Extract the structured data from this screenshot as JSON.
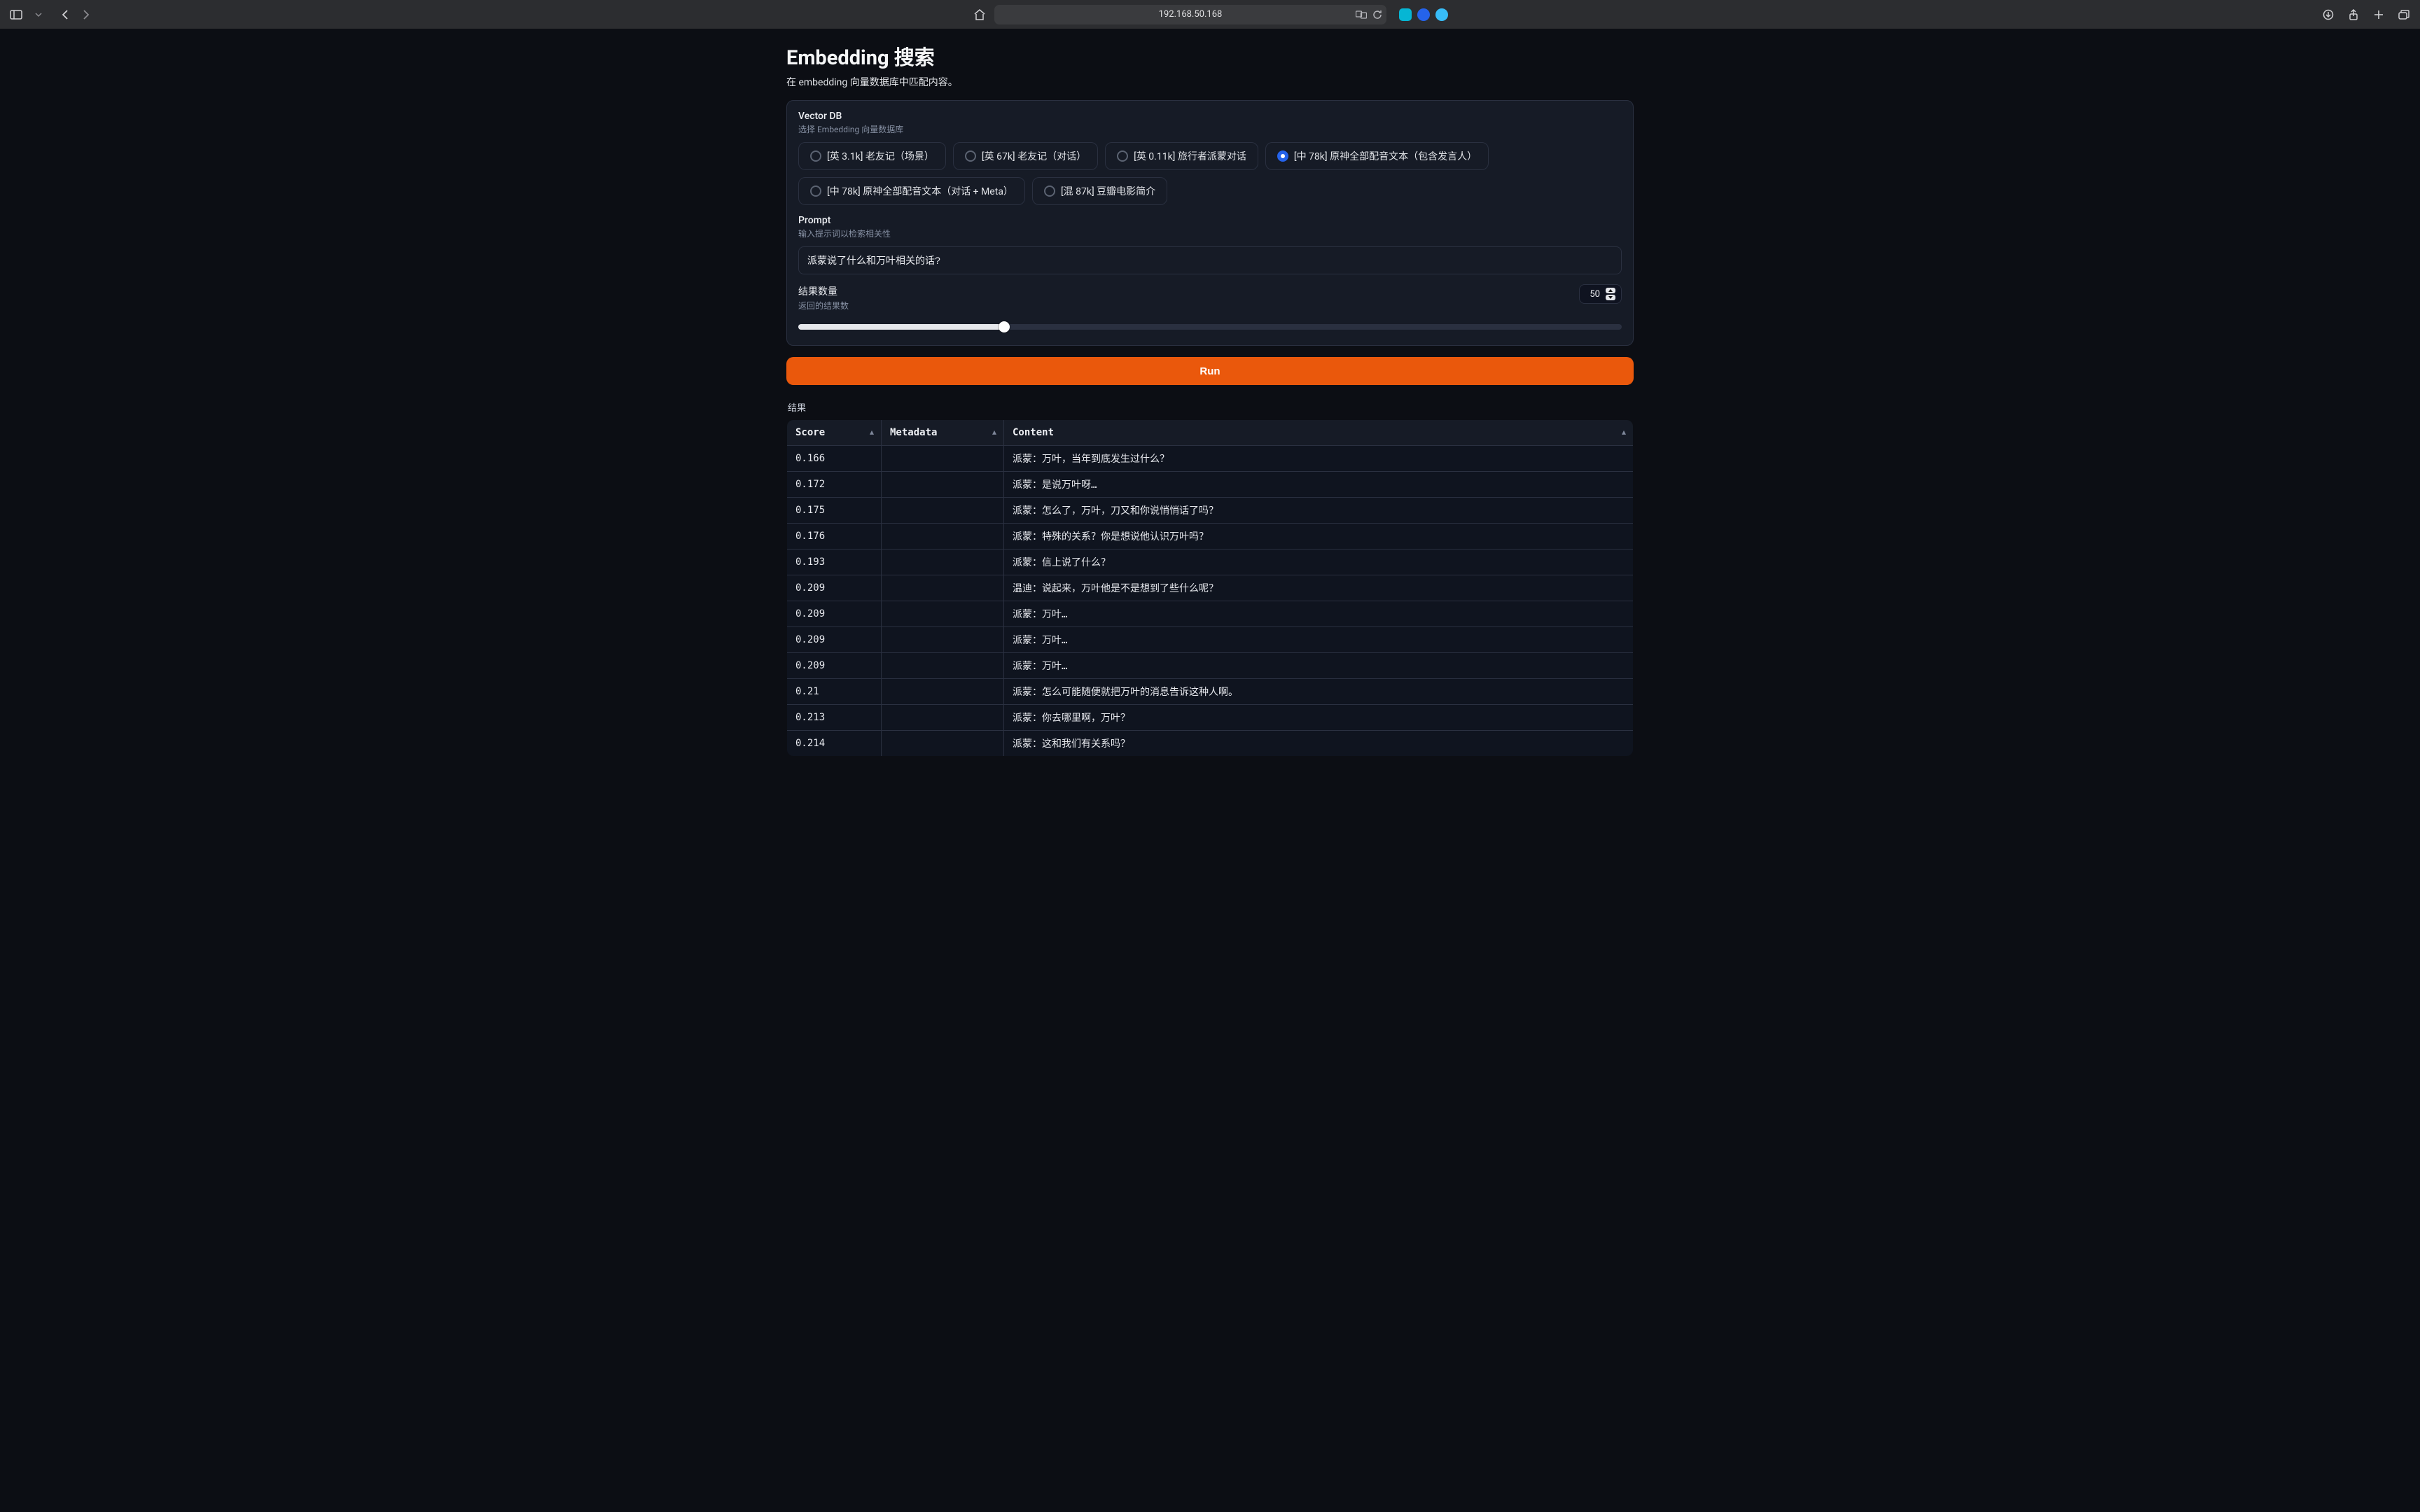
{
  "browser": {
    "address": "192.168.50.168"
  },
  "header": {
    "title": "Embedding 搜索",
    "subtitle": "在 embedding 向量数据库中匹配内容。"
  },
  "vector_db": {
    "label": "Vector DB",
    "help": "选择 Embedding 向量数据库",
    "options": [
      {
        "label": "[英 3.1k] 老友记（场景）",
        "selected": false
      },
      {
        "label": "[英 67k] 老友记（对话）",
        "selected": false
      },
      {
        "label": "[英 0.11k] 旅行者派蒙对话",
        "selected": false
      },
      {
        "label": "[中 78k] 原神全部配音文本（包含发言人）",
        "selected": true
      },
      {
        "label": "[中 78k] 原神全部配音文本（对话 + Meta）",
        "selected": false
      },
      {
        "label": "[混 87k] 豆瓣电影简介",
        "selected": false
      }
    ]
  },
  "prompt": {
    "label": "Prompt",
    "help": "输入提示词以检索相关性",
    "value": "派蒙说了什么和万叶相关的话?"
  },
  "count": {
    "label": "结果数量",
    "help": "返回的结果数",
    "value": "50",
    "percent": 25
  },
  "run_label": "Run",
  "results": {
    "label": "结果",
    "columns": {
      "score": "Score",
      "metadata": "Metadata",
      "content": "Content"
    },
    "rows": [
      {
        "score": "0.166",
        "metadata": "",
        "content": "派蒙：万叶，当年到底发生过什么？"
      },
      {
        "score": "0.172",
        "metadata": "",
        "content": "派蒙：是说万叶呀…"
      },
      {
        "score": "0.175",
        "metadata": "",
        "content": "派蒙：怎么了，万叶，刀又和你说悄悄话了吗？"
      },
      {
        "score": "0.176",
        "metadata": "",
        "content": "派蒙：特殊的关系？你是想说他认识万叶吗？"
      },
      {
        "score": "0.193",
        "metadata": "",
        "content": "派蒙：信上说了什么？"
      },
      {
        "score": "0.209",
        "metadata": "",
        "content": "温迪：说起来，万叶他是不是想到了些什么呢？"
      },
      {
        "score": "0.209",
        "metadata": "",
        "content": "派蒙：万叶…"
      },
      {
        "score": "0.209",
        "metadata": "",
        "content": "派蒙：万叶…"
      },
      {
        "score": "0.209",
        "metadata": "",
        "content": "派蒙：万叶…"
      },
      {
        "score": "0.21",
        "metadata": "",
        "content": "派蒙：怎么可能随便就把万叶的消息告诉这种人啊。"
      },
      {
        "score": "0.213",
        "metadata": "",
        "content": "派蒙：你去哪里啊，万叶？"
      },
      {
        "score": "0.214",
        "metadata": "",
        "content": "派蒙：这和我们有关系吗？"
      }
    ]
  }
}
